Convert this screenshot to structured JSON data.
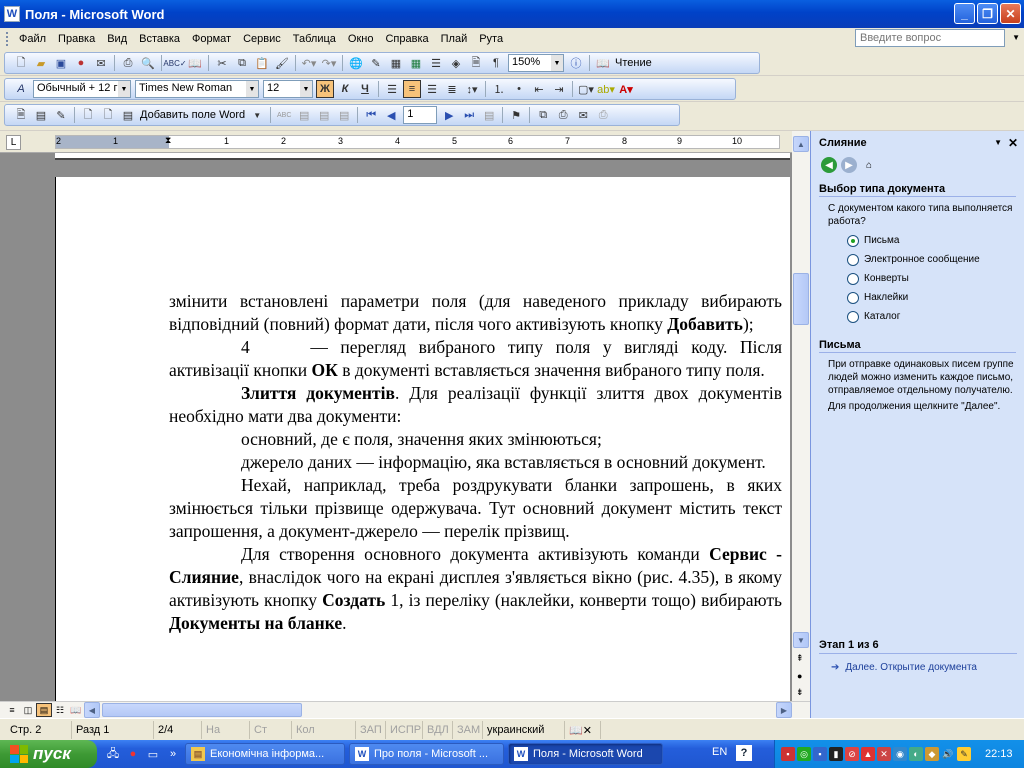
{
  "window": {
    "title": "Поля - Microsoft Word",
    "app_icon": "W"
  },
  "menu": {
    "items": [
      "Файл",
      "Правка",
      "Вид",
      "Вставка",
      "Формат",
      "Сервис",
      "Таблица",
      "Окно",
      "Справка",
      "Плай",
      "Рута"
    ],
    "help_placeholder": "Введите вопрос"
  },
  "toolbar1": {
    "zoom": "150%",
    "reading_label": "Чтение"
  },
  "toolbar2": {
    "style": "Обычный + 12 г",
    "font": "Times New Roman",
    "size": "12",
    "bold": "Ж",
    "italic": "К",
    "underline": "Ч"
  },
  "toolbar3": {
    "insert_field": "Добавить поле Word",
    "record_number": "1"
  },
  "ruler": {
    "labels": [
      "2",
      "1",
      "1",
      "2",
      "3",
      "4",
      "5",
      "6",
      "7",
      "8",
      "9",
      "10"
    ]
  },
  "document": {
    "p1_a": "змінити встановлені параметри поля (для наведеного прикладу вибирають відповідний (повний) формат дати, після чого активізують кнопку ",
    "p1_b": "Добавить",
    "p1_c": ");",
    "p2_num": "4",
    "p2_a": " — перегляд вибраного типу поля у вигляді коду. Після активізації кнопки ",
    "p2_b": "ОК",
    "p2_c": " в документі вставляється значення вибраного типу поля.",
    "p3_b": "Злиття документів",
    "p3_c": ". Для реалізації функції злиття двох документів необхідно мати два документи:",
    "p4": "основний, де є поля, значення яких змінюються;",
    "p5": "джерело даних — інформацію, яка вставляється в основний документ.",
    "p6": "Нехай, наприклад, треба роздрукувати бланки запрошень, в яких змінюється тільки прізвище одержувача. Тут основний документ містить текст запрошення, а документ-джерело — перелік прізвищ.",
    "p7_a": "Для створення основного документа активізують команди ",
    "p7_b": "Сервис - Слияние",
    "p7_c": ", внаслідок чого на екрані дисплея з'являється вікно (рис. 4.35), в якому активізують кнопку ",
    "p7_d": "Создать",
    "p7_e": " 1, із переліку (наклейки, конверти тощо) вибирають ",
    "p7_f": "Документы на бланке",
    "p7_g": "."
  },
  "taskpane": {
    "title": "Слияние",
    "section1": "Выбор типа документа",
    "question": "С документом какого типа выполняется работа?",
    "options": [
      "Письма",
      "Электронное сообщение",
      "Конверты",
      "Наклейки",
      "Каталог"
    ],
    "selected": 0,
    "section2": "Письма",
    "desc": "При отправке одинаковых писем группе людей можно изменить каждое письмо, отправляемое отдельному получателю.",
    "next_hint": "Для продолжения щелкните \"Далее\".",
    "step": "Этап 1 из 6",
    "next_link": "Далее. Открытие документа"
  },
  "status": {
    "page": "Стр. 2",
    "section": "Разд 1",
    "pages": "2/4",
    "at": "На",
    "line": "Ст",
    "col": "Кол",
    "rec": "ЗАП",
    "trk": "ИСПР",
    "ext": "ВДЛ",
    "ovr": "ЗАМ",
    "lang": "украинский"
  },
  "taskbar": {
    "start": "пуск",
    "tasks": [
      "Економічна інформа...",
      "Про поля - Microsoft ...",
      "Поля - Microsoft Word"
    ],
    "lang": "EN",
    "time": "22:13"
  }
}
